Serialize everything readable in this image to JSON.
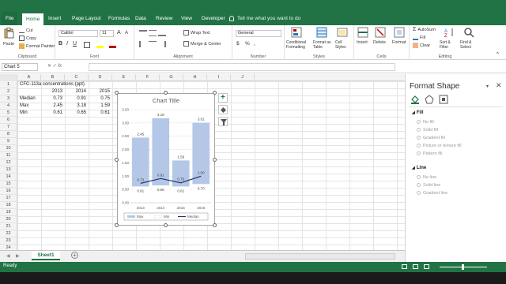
{
  "tabs": [
    "File",
    "Home",
    "Insert",
    "Page Layout",
    "Formulas",
    "Data",
    "Review",
    "View",
    "Developer"
  ],
  "tell_me": "Tell me what you want to do",
  "ribbon": {
    "clipboard": {
      "paste": "Paste",
      "cut": "Cut",
      "copy": "Copy",
      "format_painter": "Format Painter",
      "label": "Clipboard"
    },
    "font": {
      "name": "Calibri",
      "size": "11",
      "label": "Font"
    },
    "alignment": {
      "wrap": "Wrap Text",
      "merge": "Merge & Center",
      "label": "Alignment"
    },
    "number": {
      "format": "General",
      "label": "Number"
    },
    "styles": {
      "conditional": "Conditional Formatting",
      "format_table": "Format as Table",
      "cell_styles": "Cell Styles",
      "label": "Styles"
    },
    "cells": {
      "insert": "Insert",
      "delete": "Delete",
      "format": "Format",
      "label": "Cells"
    },
    "editing": {
      "autosum": "AutoSum",
      "fill": "Fill",
      "clear": "Clear",
      "sort": "Sort & Filter",
      "find": "Find & Select",
      "label": "Editing"
    }
  },
  "namebox": "Chart 5",
  "columns": [
    "A",
    "B",
    "C",
    "D",
    "E",
    "F",
    "G",
    "H",
    "I",
    "J"
  ],
  "rows": [
    "1",
    "2",
    "3",
    "4",
    "5",
    "6",
    "7",
    "8",
    "9",
    "10",
    "11",
    "12",
    "13",
    "14",
    "15",
    "16",
    "17",
    "18",
    "19",
    "20",
    "21",
    "22",
    "23",
    "24"
  ],
  "sheet": {
    "title": "CFC-113a concentrations (ppt)",
    "headers": [
      "2013",
      "2014",
      "2015"
    ],
    "data": [
      {
        "label": "Median",
        "values": [
          "0.73",
          "0.91",
          "0.75"
        ]
      },
      {
        "label": "Max",
        "values": [
          "2.45",
          "3.18",
          "1.59"
        ]
      },
      {
        "label": "Min",
        "values": [
          "0.61",
          "0.65",
          "0.61"
        ]
      }
    ]
  },
  "chart_data": {
    "type": "bar",
    "title": "Chart Title",
    "categories": [
      "2013",
      "2014",
      "2015",
      "2016"
    ],
    "ylim": [
      0,
      3.5
    ],
    "yticks": [
      "0.00",
      "0.50",
      "1.00",
      "1.50",
      "2.00",
      "2.50",
      "3.00",
      "3.50"
    ],
    "series": [
      {
        "name": "Max",
        "kind": "bar",
        "values": [
          2.45,
          3.18,
          1.59,
          3.01
        ],
        "color": "#b4c7e7"
      },
      {
        "name": "Min",
        "kind": "bar",
        "values": [
          0.61,
          0.65,
          0.61,
          0.7
        ],
        "color": "#ffffff"
      },
      {
        "name": "Median",
        "kind": "line",
        "values": [
          0.73,
          0.91,
          0.75,
          1.0
        ],
        "color": "#1f3864"
      }
    ],
    "legend": "bottom"
  },
  "pane": {
    "title": "Format Shape",
    "fill_label": "Fill",
    "fill_options": [
      "No fill",
      "Solid fill",
      "Gradient fill",
      "Picture or texture fill",
      "Pattern fill"
    ],
    "line_label": "Line",
    "line_options": [
      "No line",
      "Solid line",
      "Gradient line"
    ]
  },
  "sheet_tab": "Sheet1",
  "status": "Ready",
  "colors": {
    "excel_green": "#217346",
    "bar": "#b4c7e7",
    "median_line": "#1f3864"
  }
}
